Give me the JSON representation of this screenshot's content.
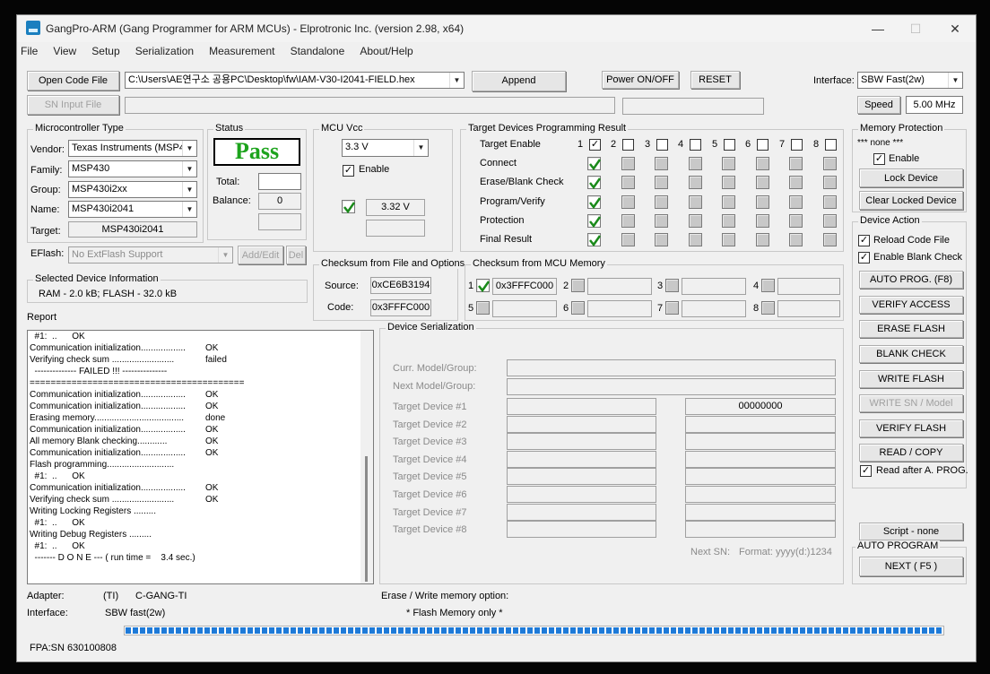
{
  "window": {
    "title": "GangPro-ARM (Gang Programmer for ARM MCUs) - Elprotronic Inc. (version 2.98, x64)"
  },
  "menu": [
    "File",
    "View",
    "Setup",
    "Serialization",
    "Measurement",
    "Standalone",
    "About/Help"
  ],
  "toolbar": {
    "open_code_file": "Open Code File",
    "code_file_path": "C:\\Users\\AE연구소 공용PC\\Desktop\\fw\\IAM-V30-I2041-FIELD.hex",
    "append": "Append",
    "sn_input_file": "SN Input File",
    "power_onoff": "Power ON/OFF",
    "reset": "RESET",
    "interface_label": "Interface:",
    "interface_value": "SBW Fast(2w)",
    "speed": "Speed",
    "speed_value": "5.00 MHz"
  },
  "micro": {
    "title": "Microcontroller Type",
    "vendor_label": "Vendor:",
    "vendor": "Texas Instruments (MSP4",
    "family_label": "Family:",
    "family": "MSP430",
    "group_label": "Group:",
    "group": "MSP430i2xx",
    "name_label": "Name:",
    "name": "MSP430i2041",
    "target_label": "Target:",
    "target": "MSP430i2041",
    "eflash_label": "EFlash:",
    "eflash": "No ExtFlash Support",
    "addedit": "Add/Edit",
    "del": "Del"
  },
  "status": {
    "title": "Status",
    "result": "Pass",
    "total_label": "Total:",
    "total": "",
    "balance_label": "Balance:",
    "balance": "0"
  },
  "vcc": {
    "title": "MCU Vcc",
    "value": "3.3 V",
    "enable": "Enable",
    "measured": "3.32 V"
  },
  "targets": {
    "title": "Target Devices Programming Result",
    "rows": [
      "Target Enable",
      "Connect",
      "Erase/Blank Check",
      "Program/Verify",
      "Protection",
      "Final Result"
    ],
    "numbers": [
      "1",
      "2",
      "3",
      "4",
      "5",
      "6",
      "7",
      "8"
    ]
  },
  "memprot": {
    "title": "Memory Protection",
    "none": "*** none ***",
    "enable": "Enable",
    "lock": "Lock Device",
    "clear": "Clear Locked Device"
  },
  "selected": {
    "title": "Selected Device Information",
    "text": "RAM -   2.0 kB;   FLASH - 32.0 kB"
  },
  "checksum_file": {
    "title": "Checksum from File and Options",
    "source_label": "Source:",
    "source": "0xCE6B3194",
    "code_label": "Code:",
    "code": "0x3FFFC000"
  },
  "checksum_mcu": {
    "title": "Checksum from MCU Memory",
    "slots": [
      {
        "n": "1",
        "v": "0x3FFFC000"
      },
      {
        "n": "2",
        "v": ""
      },
      {
        "n": "3",
        "v": ""
      },
      {
        "n": "4",
        "v": ""
      },
      {
        "n": "5",
        "v": ""
      },
      {
        "n": "6",
        "v": ""
      },
      {
        "n": "7",
        "v": ""
      },
      {
        "n": "8",
        "v": ""
      }
    ]
  },
  "report": {
    "title": "Report",
    "lines": [
      [
        "  #1:  ..      OK",
        ""
      ],
      [
        "Communication initialization..................",
        "OK"
      ],
      [
        "Verifying check sum .........................",
        "failed"
      ],
      [
        "  -------------- FAILED !!! ---------------",
        ""
      ],
      [
        "=========================================",
        ""
      ],
      [
        "Communication initialization..................",
        "OK"
      ],
      [
        "Communication initialization..................",
        "OK"
      ],
      [
        "Erasing memory....................................",
        "done"
      ],
      [
        "Communication initialization..................",
        "OK"
      ],
      [
        "All memory Blank checking............",
        "OK"
      ],
      [
        "Communication initialization..................",
        "OK"
      ],
      [
        "Flash programming...........................",
        ""
      ],
      [
        "  #1:  ..      OK",
        ""
      ],
      [
        "Communication initialization..................",
        "OK"
      ],
      [
        "Verifying check sum .........................",
        "OK"
      ],
      [
        "Writing Locking Registers .........",
        ""
      ],
      [
        "  #1:  ..      OK",
        ""
      ],
      [
        "Writing Debug Registers .........",
        ""
      ],
      [
        "  #1:  ..      OK",
        ""
      ],
      [
        "  ------- D O N E --- ( run time =    3.4 sec.)",
        ""
      ]
    ]
  },
  "serial": {
    "title": "Device Serialization",
    "curr": "Curr. Model/Group:",
    "next": "Next Model/Group:",
    "devices": [
      "Target Device #1",
      "Target Device #2",
      "Target Device #3",
      "Target Device #4",
      "Target Device #5",
      "Target Device #6",
      "Target Device #7",
      "Target Device #8"
    ],
    "sn1": "00000000",
    "next_sn": "Next SN:",
    "format": "Format: yyyy(d:)1234"
  },
  "action": {
    "title": "Device Action",
    "reload": "Reload Code File",
    "blank": "Enable Blank Check",
    "auto": "AUTO PROG. (F8)",
    "verify_access": "VERIFY ACCESS",
    "erase": "ERASE FLASH",
    "blank_check": "BLANK CHECK",
    "write": "WRITE FLASH",
    "write_sn": "WRITE SN / Model",
    "verify_flash": "VERIFY FLASH",
    "read": "READ / COPY",
    "read_after": "Read after A. PROG."
  },
  "script": "Script - none",
  "autoprog": {
    "title": "AUTO PROGRAM",
    "next": "NEXT  ( F5 )"
  },
  "footer": {
    "adapter_label": "Adapter:",
    "adapter_type": "(TI)",
    "adapter_name": "C-GANG-TI",
    "interface_label": "Interface:",
    "interface": "SBW fast(2w)",
    "erase_label": "Erase / Write memory option:",
    "erase_value": "* Flash Memory only *",
    "fpa": "FPA:SN 630100808"
  },
  "progress": 1.0
}
